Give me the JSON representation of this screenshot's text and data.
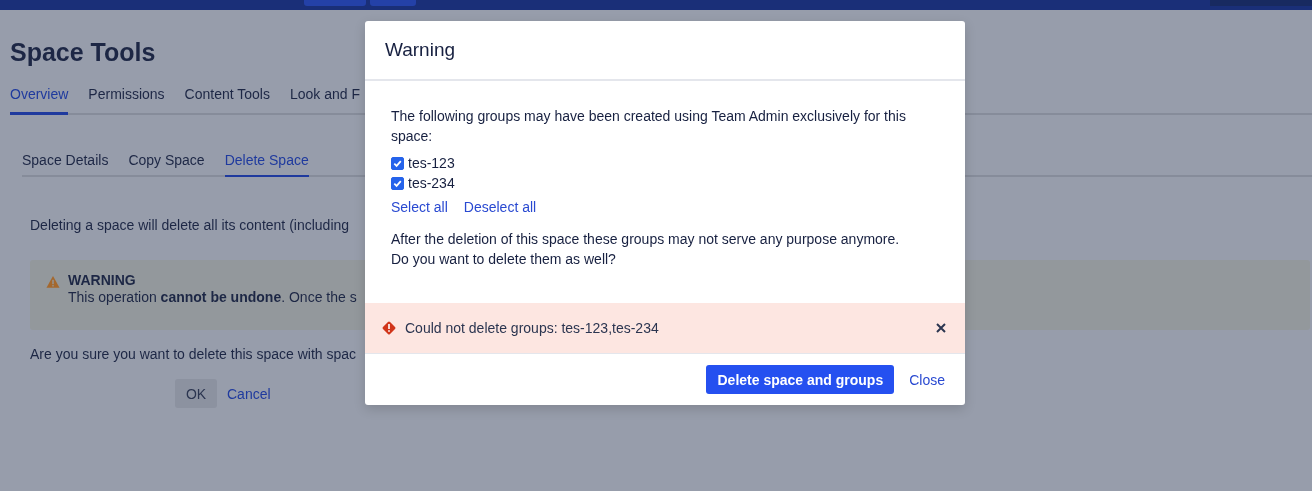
{
  "page": {
    "title": "Space Tools",
    "tabs": [
      {
        "label": "Overview",
        "selected": true
      },
      {
        "label": "Permissions",
        "selected": false
      },
      {
        "label": "Content Tools",
        "selected": false
      },
      {
        "label": "Look and F",
        "selected": false
      }
    ],
    "subtabs": [
      {
        "label": "Space Details",
        "selected": false
      },
      {
        "label": "Copy Space",
        "selected": false
      },
      {
        "label": "Delete Space",
        "selected": true
      }
    ],
    "intro": "Deleting a space will delete all its content (including",
    "warning": {
      "title": "WARNING",
      "text": "This operation **cannot be undone**. Once the s"
    },
    "question": "Are you sure you want to delete this space with spac",
    "buttons": {
      "ok": "OK",
      "cancel": "Cancel"
    }
  },
  "dialog": {
    "title": "Warning",
    "intro": "The following groups may have been created using Team Admin exclusively for this space:",
    "groups": [
      {
        "label": "tes-123",
        "checked": true
      },
      {
        "label": "tes-234",
        "checked": true
      }
    ],
    "select_all": "Select all",
    "deselect_all": "Deselect all",
    "question": [
      "After the deletion of this space these groups may not serve any purpose anymore.",
      "Do you want to delete them as well?"
    ],
    "error": "Could not delete groups: tes-123,tes-234",
    "primary": "Delete space and groups",
    "close": "Close"
  }
}
